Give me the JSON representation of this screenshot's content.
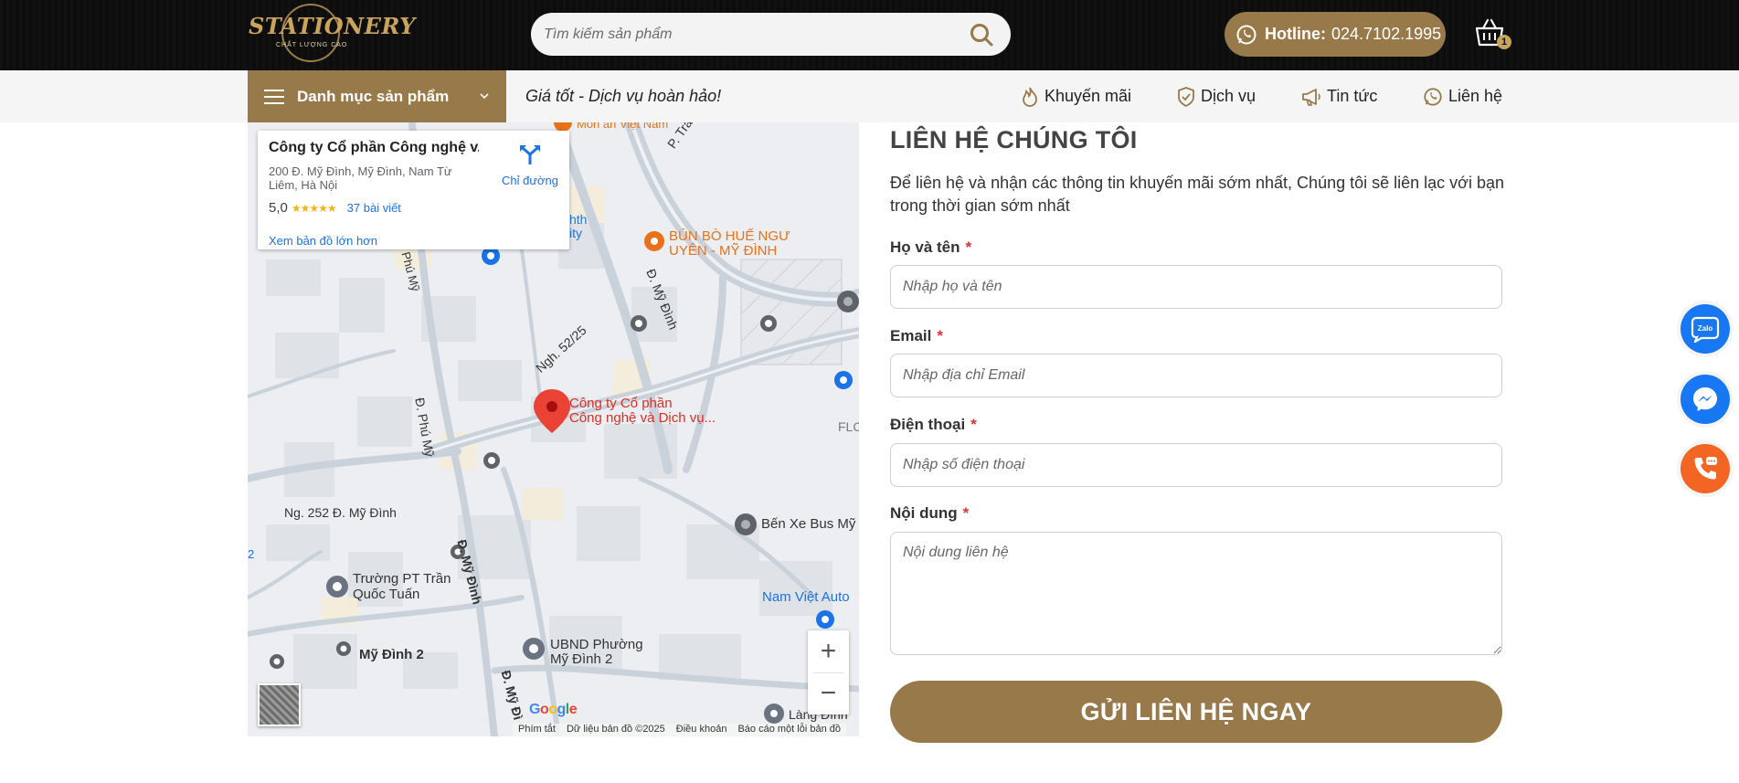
{
  "header": {
    "logo_text": "STATIONERY",
    "logo_sub": "CHẤT LƯỢNG CAO",
    "search_placeholder": "Tìm kiếm sản phẩm",
    "hotline_label": "Hotline:",
    "hotline_number": "024.7102.1995",
    "cart_count": "1"
  },
  "nav": {
    "category_label": "Danh mục sản phẩm",
    "slogan": "Giá tốt - Dịch vụ hoàn hảo!",
    "items": [
      {
        "label": "Khuyến mãi",
        "icon": "fire-icon"
      },
      {
        "label": "Dịch vụ",
        "icon": "shield-icon"
      },
      {
        "label": "Tin tức",
        "icon": "megaphone-icon"
      },
      {
        "label": "Liên hệ",
        "icon": "whatsapp-icon"
      }
    ]
  },
  "map": {
    "card": {
      "title": "Công ty Cổ phần Công nghệ v...",
      "address": "200 Đ. Mỹ Đình, Mỹ Đình, Nam Từ Liêm, Hà Nội",
      "rating": "5,0",
      "stars": "★★★★★",
      "reviews": "37 bài viết",
      "bigger_map": "Xem bản đồ lớn hơn",
      "directions": "Chỉ đường"
    },
    "labels": {
      "restaurant_top": "Món ăn Việt Nam",
      "tran_binh": "P. Trần Bình",
      "bun_bo_1": "BÚN BÒ HUẾ NGƯ",
      "bun_bo_2": "UYÊN - MỸ ĐÌNH",
      "my_dinh_road": "Đ. Mỹ Đình",
      "ngo_52": "Ngh. 52/25",
      "phu_my_top": "Phú Mỹ",
      "phu_my": "Đ. Phú Mỹ",
      "pin_1": "Công ty Cổ phần",
      "pin_2": "Công nghệ và Dịch vụ...",
      "flc": "FLC",
      "ngo_252": "Ng. 252 Đ. Mỹ Đình",
      "ben_xe": "Bến Xe Bus Mỹ",
      "nam_viet": "Nam Việt Auto",
      "truong_1": "Trường PT Trần",
      "truong_2": "Quốc Tuấn",
      "my_dinh_road_2": "Đ. Mỹ Đình",
      "my_dinh_2": "Mỹ Đình 2",
      "ubnd_1": "UBND Phường",
      "ubnd_2": "Mỹ Đình 2",
      "my_dinh_road_3": "Đ. Mỹ Đì",
      "lang_dinh": "Làng Đình",
      "hth": "hth",
      "ity": "ity",
      "edge_2": "2"
    },
    "google": "Google",
    "footer": [
      "Phím tắt",
      "Dữ liệu bản đồ ©2025",
      "Điều khoản",
      "Báo cáo một lỗi bản đồ"
    ],
    "zoom_in": "+",
    "zoom_out": "−"
  },
  "form": {
    "title": "LIÊN HỆ CHÚNG TÔI",
    "description": "Để liên hệ và nhận các thông tin khuyến mãi sớm nhất, Chúng tôi sẽ liên lạc với bạn trong thời gian sớm nhất",
    "required_mark": "*",
    "fields": {
      "name": {
        "label": "Họ và tên",
        "placeholder": "Nhập họ và tên"
      },
      "email": {
        "label": "Email",
        "placeholder": "Nhập địa chỉ Email"
      },
      "phone": {
        "label": "Điện thoại",
        "placeholder": "Nhập số điện thoại"
      },
      "message": {
        "label": "Nội dung",
        "placeholder": "Nội dung liên hệ"
      }
    },
    "submit_label": "GỬI LIÊN HỆ NGAY"
  },
  "floating": {
    "zalo_text": "Zalo",
    "colors": {
      "zalo": "#1877f2",
      "messenger": "#1877f2",
      "phone": "#f26522"
    }
  },
  "colors": {
    "brand_gold": "#98794a",
    "header_bg": "#0d0d0d",
    "link_blue": "#1a73e8"
  }
}
